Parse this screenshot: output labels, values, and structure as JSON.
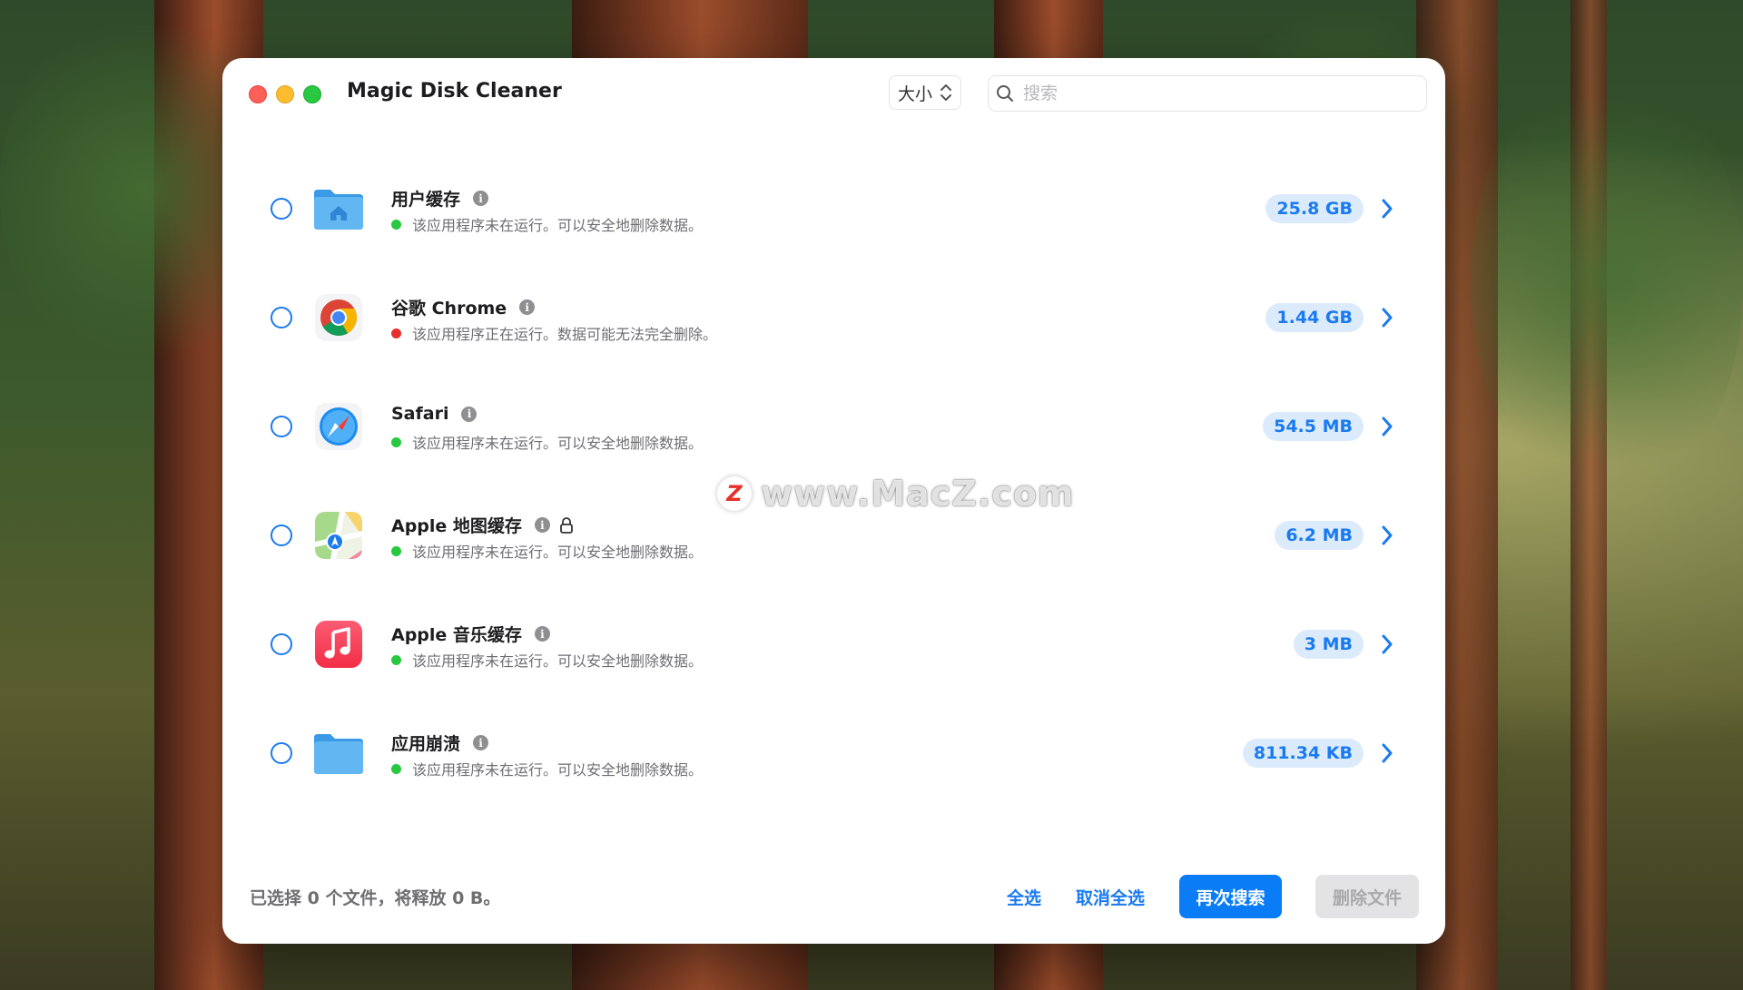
{
  "window": {
    "title": "Magic Disk Cleaner"
  },
  "toolbar": {
    "sort_label": "大小",
    "search_placeholder": "搜索"
  },
  "items": [
    {
      "name": "用户缓存",
      "status": "该应用程序未在运行。可以安全地删除数据。",
      "running": false,
      "size": "25.8 GB",
      "icon": "home-folder-icon",
      "locked": false
    },
    {
      "name": "谷歌 Chrome",
      "status": "该应用程序正在运行。数据可能无法完全删除。",
      "running": true,
      "size": "1.44 GB",
      "icon": "chrome-icon",
      "locked": false
    },
    {
      "name": "Safari",
      "status": "该应用程序未在运行。可以安全地删除数据。",
      "running": false,
      "size": "54.5 MB",
      "icon": "safari-icon",
      "locked": false
    },
    {
      "name": "Apple 地图缓存",
      "status": "该应用程序未在运行。可以安全地删除数据。",
      "running": false,
      "size": "6.2 MB",
      "icon": "maps-icon",
      "locked": true
    },
    {
      "name": "Apple 音乐缓存",
      "status": "该应用程序未在运行。可以安全地删除数据。",
      "running": false,
      "size": "3 MB",
      "icon": "music-icon",
      "locked": false
    },
    {
      "name": "应用崩溃",
      "status": "该应用程序未在运行。可以安全地删除数据。",
      "running": false,
      "size": "811.34 KB",
      "icon": "folder-icon",
      "locked": false
    }
  ],
  "footer": {
    "selection_status": "已选择 0 个文件，将释放 0 B。",
    "select_all": "全选",
    "deselect_all": "取消全选",
    "search_again": "再次搜索",
    "delete_files": "删除文件"
  },
  "colors": {
    "accent": "#0a7cf5",
    "ok": "#28c840",
    "running": "#e5302c",
    "badge_bg": "#dcebfb"
  },
  "watermark": {
    "logo": "Z",
    "text": "www.MacZ.com"
  }
}
